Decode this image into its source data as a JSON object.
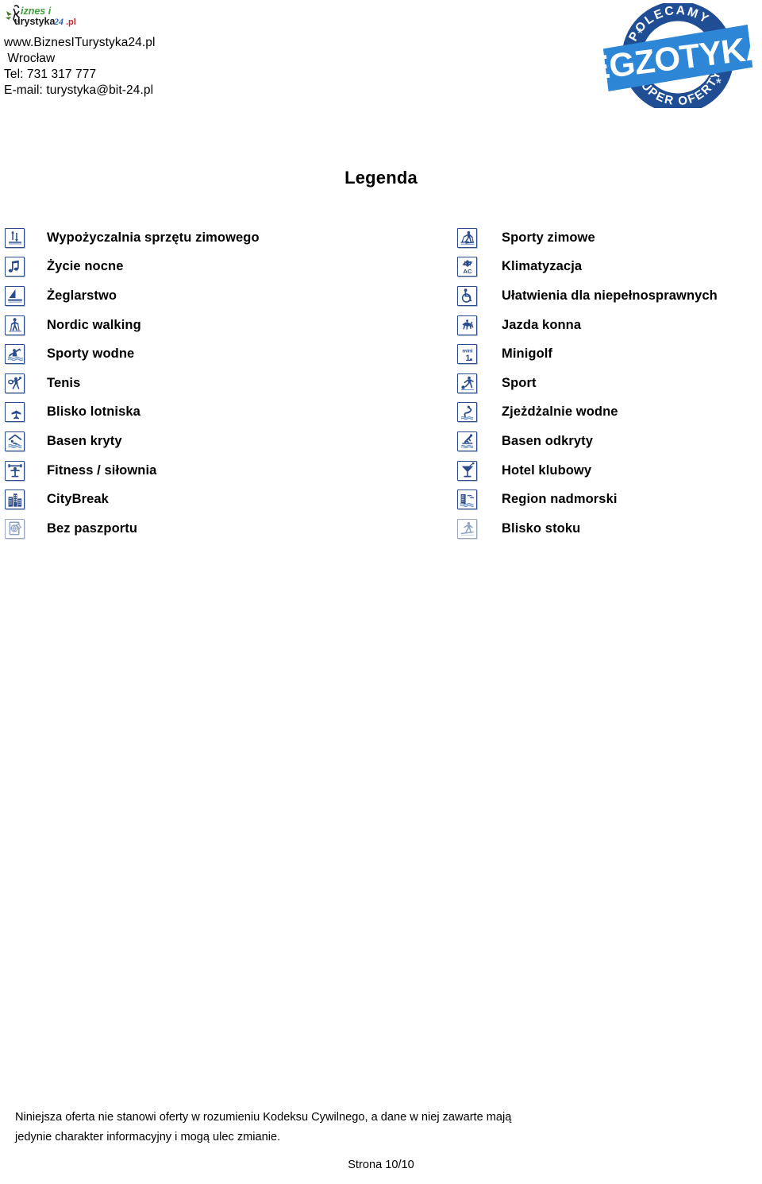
{
  "header": {
    "logo": {
      "icon": "biznes-i-turystyka-logo",
      "part1": "iznes i",
      "part2": "urystyka",
      "part3": "24",
      "part4": ".pl"
    },
    "website": "www.BiznesITurystyka24.pl",
    "city": " Wrocław",
    "phone": "Tel: 731 317 777",
    "email": "E-mail: turystyka@bit-24.pl",
    "stamp": {
      "top_text": "POLECAMY",
      "bottom_text": "SUPER OFERTY",
      "banner_text": "EGZOTYKA",
      "color_dark": "#1f4e95",
      "color_light": "#2e86d6"
    }
  },
  "legend": {
    "title": "Legenda",
    "left_column": [
      {
        "icon": "ski-rental-icon",
        "label": "Wypożyczalnia sprzętu  zimowego"
      },
      {
        "icon": "nightlife-music-icon",
        "label": "Życie nocne"
      },
      {
        "icon": "sailing-boat-icon",
        "label": "Żeglarstwo"
      },
      {
        "icon": "nordic-walking-icon",
        "label": "Nordic walking"
      },
      {
        "icon": "water-sports-kayak-icon",
        "label": "Sporty wodne"
      },
      {
        "icon": "tennis-icon",
        "label": "Tenis"
      },
      {
        "icon": "airplane-icon",
        "label": "Blisko lotniska"
      },
      {
        "icon": "indoor-pool-icon",
        "label": "Basen kryty"
      },
      {
        "icon": "fitness-gym-icon",
        "label": "Fitness / siłownia"
      },
      {
        "icon": "city-buildings-icon",
        "label": "CityBreak"
      },
      {
        "icon": "no-passport-icon",
        "label": "Bez paszportu",
        "muted": true
      }
    ],
    "right_column": [
      {
        "icon": "winter-sports-icon",
        "label": "Sporty zimowe"
      },
      {
        "icon": "air-conditioning-icon",
        "label": "Klimatyzacja"
      },
      {
        "icon": "wheelchair-access-icon",
        "label": "Ułatwienia dla  niepełnosprawnych"
      },
      {
        "icon": "horse-riding-icon",
        "label": "Jazda konna"
      },
      {
        "icon": "minigolf-icon",
        "label": "Minigolf"
      },
      {
        "icon": "sport-football-icon",
        "label": "Sport"
      },
      {
        "icon": "water-slide-icon",
        "label": "Zjeżdżalnie wodne"
      },
      {
        "icon": "outdoor-pool-icon",
        "label": "Basen odkryty"
      },
      {
        "icon": "cocktail-glass-icon",
        "label": "Hotel klubowy"
      },
      {
        "icon": "seaside-region-icon",
        "label": "Region nadmorski"
      },
      {
        "icon": "near-slope-icon",
        "label": "Blisko stoku",
        "muted": true
      }
    ]
  },
  "footer": {
    "disclaimer_line1": "Niniejsza oferta nie stanowi oferty w rozumieniu Kodeksu Cywilnego, a dane w niej zawarte mają",
    "disclaimer_line2": "jedynie charakter informacyjny i mogą ulec zmianie.",
    "page_number": "Strona 10/10"
  }
}
